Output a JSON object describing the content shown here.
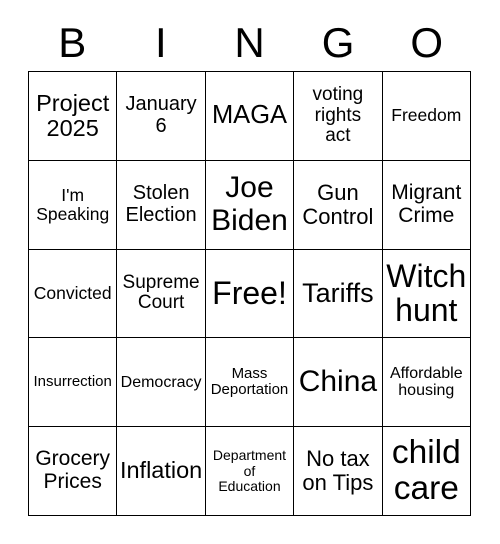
{
  "card": {
    "header_letters": [
      "B",
      "I",
      "N",
      "G",
      "O"
    ],
    "free_space_label": "Free!",
    "colors": {
      "background": "#ffffff",
      "text": "#000000",
      "grid_line": "#000000"
    },
    "rows": [
      [
        {
          "text": "Project\n2025",
          "size": "fs-23"
        },
        {
          "text": "January\n6",
          "size": "fs-20"
        },
        {
          "text": "MAGA",
          "size": "fs-25"
        },
        {
          "text": "voting\nrights\nact",
          "size": "fs-19"
        },
        {
          "text": "Freedom",
          "size": "fs-17"
        }
      ],
      [
        {
          "text": "I'm\nSpeaking",
          "size": "fs-17"
        },
        {
          "text": "Stolen\nElection",
          "size": "fs-20"
        },
        {
          "text": "Joe\nBiden",
          "size": "fs-30"
        },
        {
          "text": "Gun\nControl",
          "size": "fs-22"
        },
        {
          "text": "Migrant\nCrime",
          "size": "fs-21"
        }
      ],
      [
        {
          "text": "Convicted",
          "size": "fs-17"
        },
        {
          "text": "Supreme\nCourt",
          "size": "fs-19"
        },
        {
          "text": "Free!",
          "size": "fs-32"
        },
        {
          "text": "Tariffs",
          "size": "fs-27"
        },
        {
          "text": "Witch\nhunt",
          "size": "fs-32"
        }
      ],
      [
        {
          "text": "Insurrection",
          "size": "fs-15"
        },
        {
          "text": "Democracy",
          "size": "fs-16"
        },
        {
          "text": "Mass\nDeportation",
          "size": "fs-15"
        },
        {
          "text": "China",
          "size": "fs-30"
        },
        {
          "text": "Affordable\nhousing",
          "size": "fs-16"
        }
      ],
      [
        {
          "text": "Grocery\nPrices",
          "size": "fs-21"
        },
        {
          "text": "Inflation",
          "size": "fs-23"
        },
        {
          "text": "Department\nof\nEducation",
          "size": "fs-14"
        },
        {
          "text": "No tax\non Tips",
          "size": "fs-22"
        },
        {
          "text": "child\ncare",
          "size": "fs-33"
        }
      ]
    ]
  }
}
